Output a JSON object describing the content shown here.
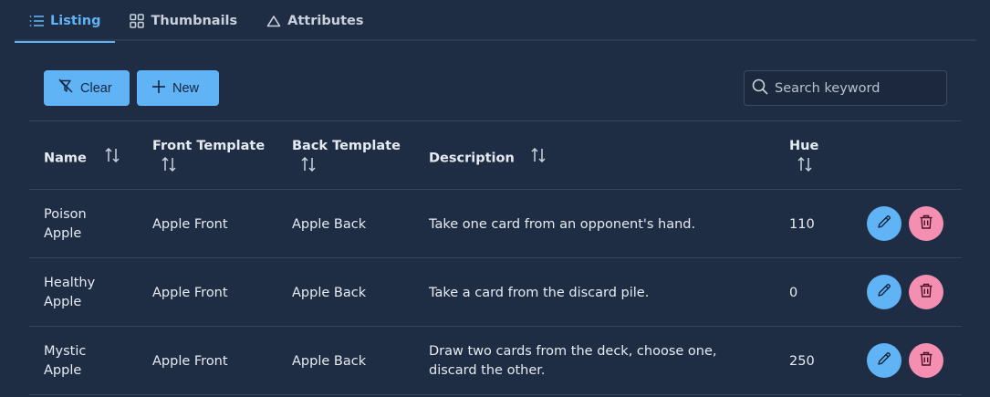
{
  "tabs": [
    {
      "label": "Listing",
      "icon": "list-icon",
      "active": true
    },
    {
      "label": "Thumbnails",
      "icon": "grid-icon",
      "active": false
    },
    {
      "label": "Attributes",
      "icon": "triangle-icon",
      "active": false
    }
  ],
  "toolbar": {
    "clear_label": "Clear",
    "new_label": "New",
    "search_placeholder": "Search keyword"
  },
  "table": {
    "headers": {
      "name": "Name",
      "front": "Front Template",
      "back": "Back Template",
      "description": "Description",
      "hue": "Hue"
    },
    "rows": [
      {
        "name": "Poison Apple",
        "front": "Apple Front",
        "back": "Apple Back",
        "description": "Take one card from an opponent's hand.",
        "hue": "110"
      },
      {
        "name": "Healthy Apple",
        "front": "Apple Front",
        "back": "Apple Back",
        "description": "Take a card from the discard pile.",
        "hue": "0"
      },
      {
        "name": "Mystic Apple",
        "front": "Apple Front",
        "back": "Apple Back",
        "description": "Draw two cards from the deck, choose one, discard the other.",
        "hue": "250"
      }
    ]
  },
  "colors": {
    "background": "#1f2d44",
    "accent": "#60b3f5",
    "delete": "#f48fb1"
  }
}
